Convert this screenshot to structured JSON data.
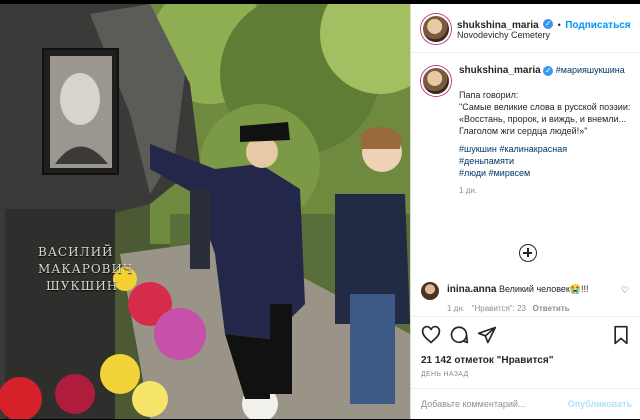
{
  "header": {
    "username": "shukshina_maria",
    "follow_label": "Подписаться",
    "location": "Novodevichy Cemetery"
  },
  "caption": {
    "username": "shukshina_maria",
    "tag_inline": "#марияшукшина",
    "text_line1": "Папа говорил:",
    "text_quote": "\"Самые великие слова в русской поэзии: «Восстань, пророк, и виждь, и внемли... Глаголом жги сердца людей!»\"",
    "hashtags": [
      "#шукшин",
      "#калинакрасная",
      "#деньпамяти",
      "#люди",
      "#мирвсем"
    ],
    "age": "1 дн."
  },
  "comment": {
    "username": "inina.anna",
    "text": "Великий человек😭!!!",
    "meta_age": "1 дн.",
    "meta_likes": "\"Нравится\": 23",
    "meta_reply": "Ответить"
  },
  "actions": {
    "likes_text": "21 142 отметок \"Нравится\"",
    "when": "ДЕНЬ НАЗАД",
    "add_placeholder": "Добавьте комментарий...",
    "publish_label": "Опубликовать"
  },
  "photo": {
    "grave_inscription": [
      "ВАСИЛИЙ",
      "МАКАРОВИЧ",
      "ШУКШИН"
    ]
  },
  "colors": {
    "link_blue": "#0095f6",
    "verified_blue": "#3897f0",
    "hashtag": "#00376b",
    "muted": "#8e8e8e"
  }
}
